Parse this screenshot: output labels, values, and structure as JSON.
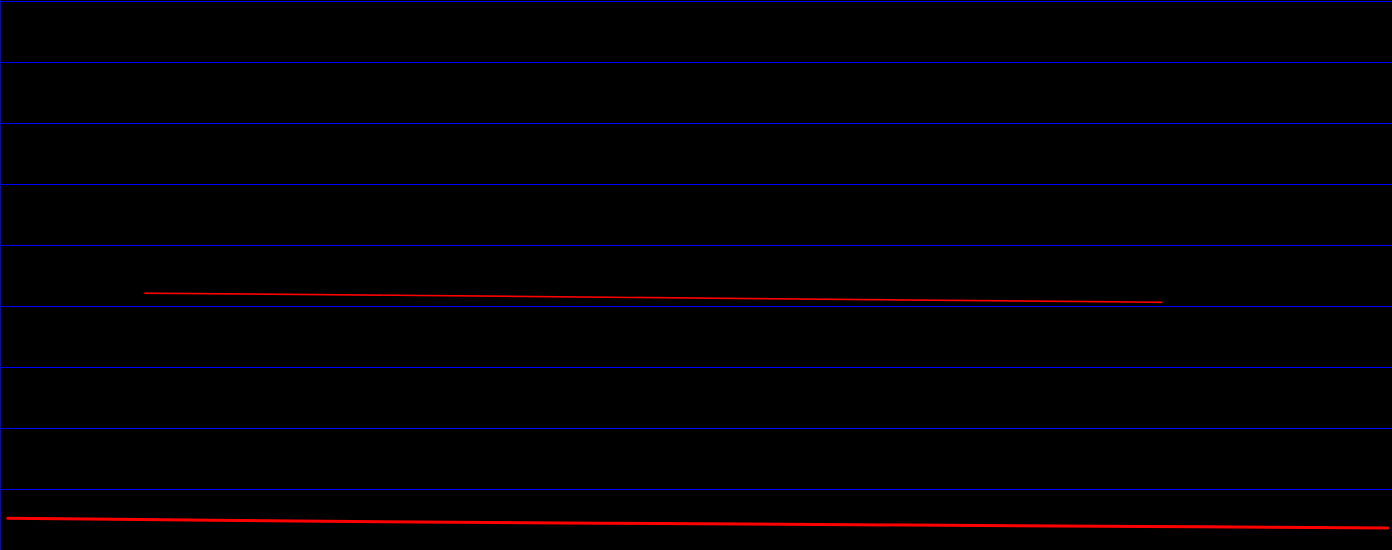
{
  "colors": {
    "background": "#000000",
    "grid": "#0000ff",
    "series": "#ff0000"
  },
  "chart_data": {
    "type": "line",
    "title": "",
    "xlabel": "",
    "ylabel": "",
    "grid": true,
    "legend": "none",
    "xlim": [
      0,
      1392
    ],
    "ylim": [
      0,
      9
    ],
    "series": [
      {
        "x": [
          145,
          300,
          500,
          700,
          900,
          1100,
          1162
        ],
        "y": [
          4.21,
          4.19,
          4.16,
          4.13,
          4.1,
          4.07,
          4.06
        ]
      },
      {
        "x": [
          8,
          200,
          400,
          600,
          800,
          1000,
          1200,
          1388
        ],
        "y": [
          0.52,
          0.49,
          0.46,
          0.44,
          0.42,
          0.4,
          0.38,
          0.36
        ]
      }
    ]
  }
}
